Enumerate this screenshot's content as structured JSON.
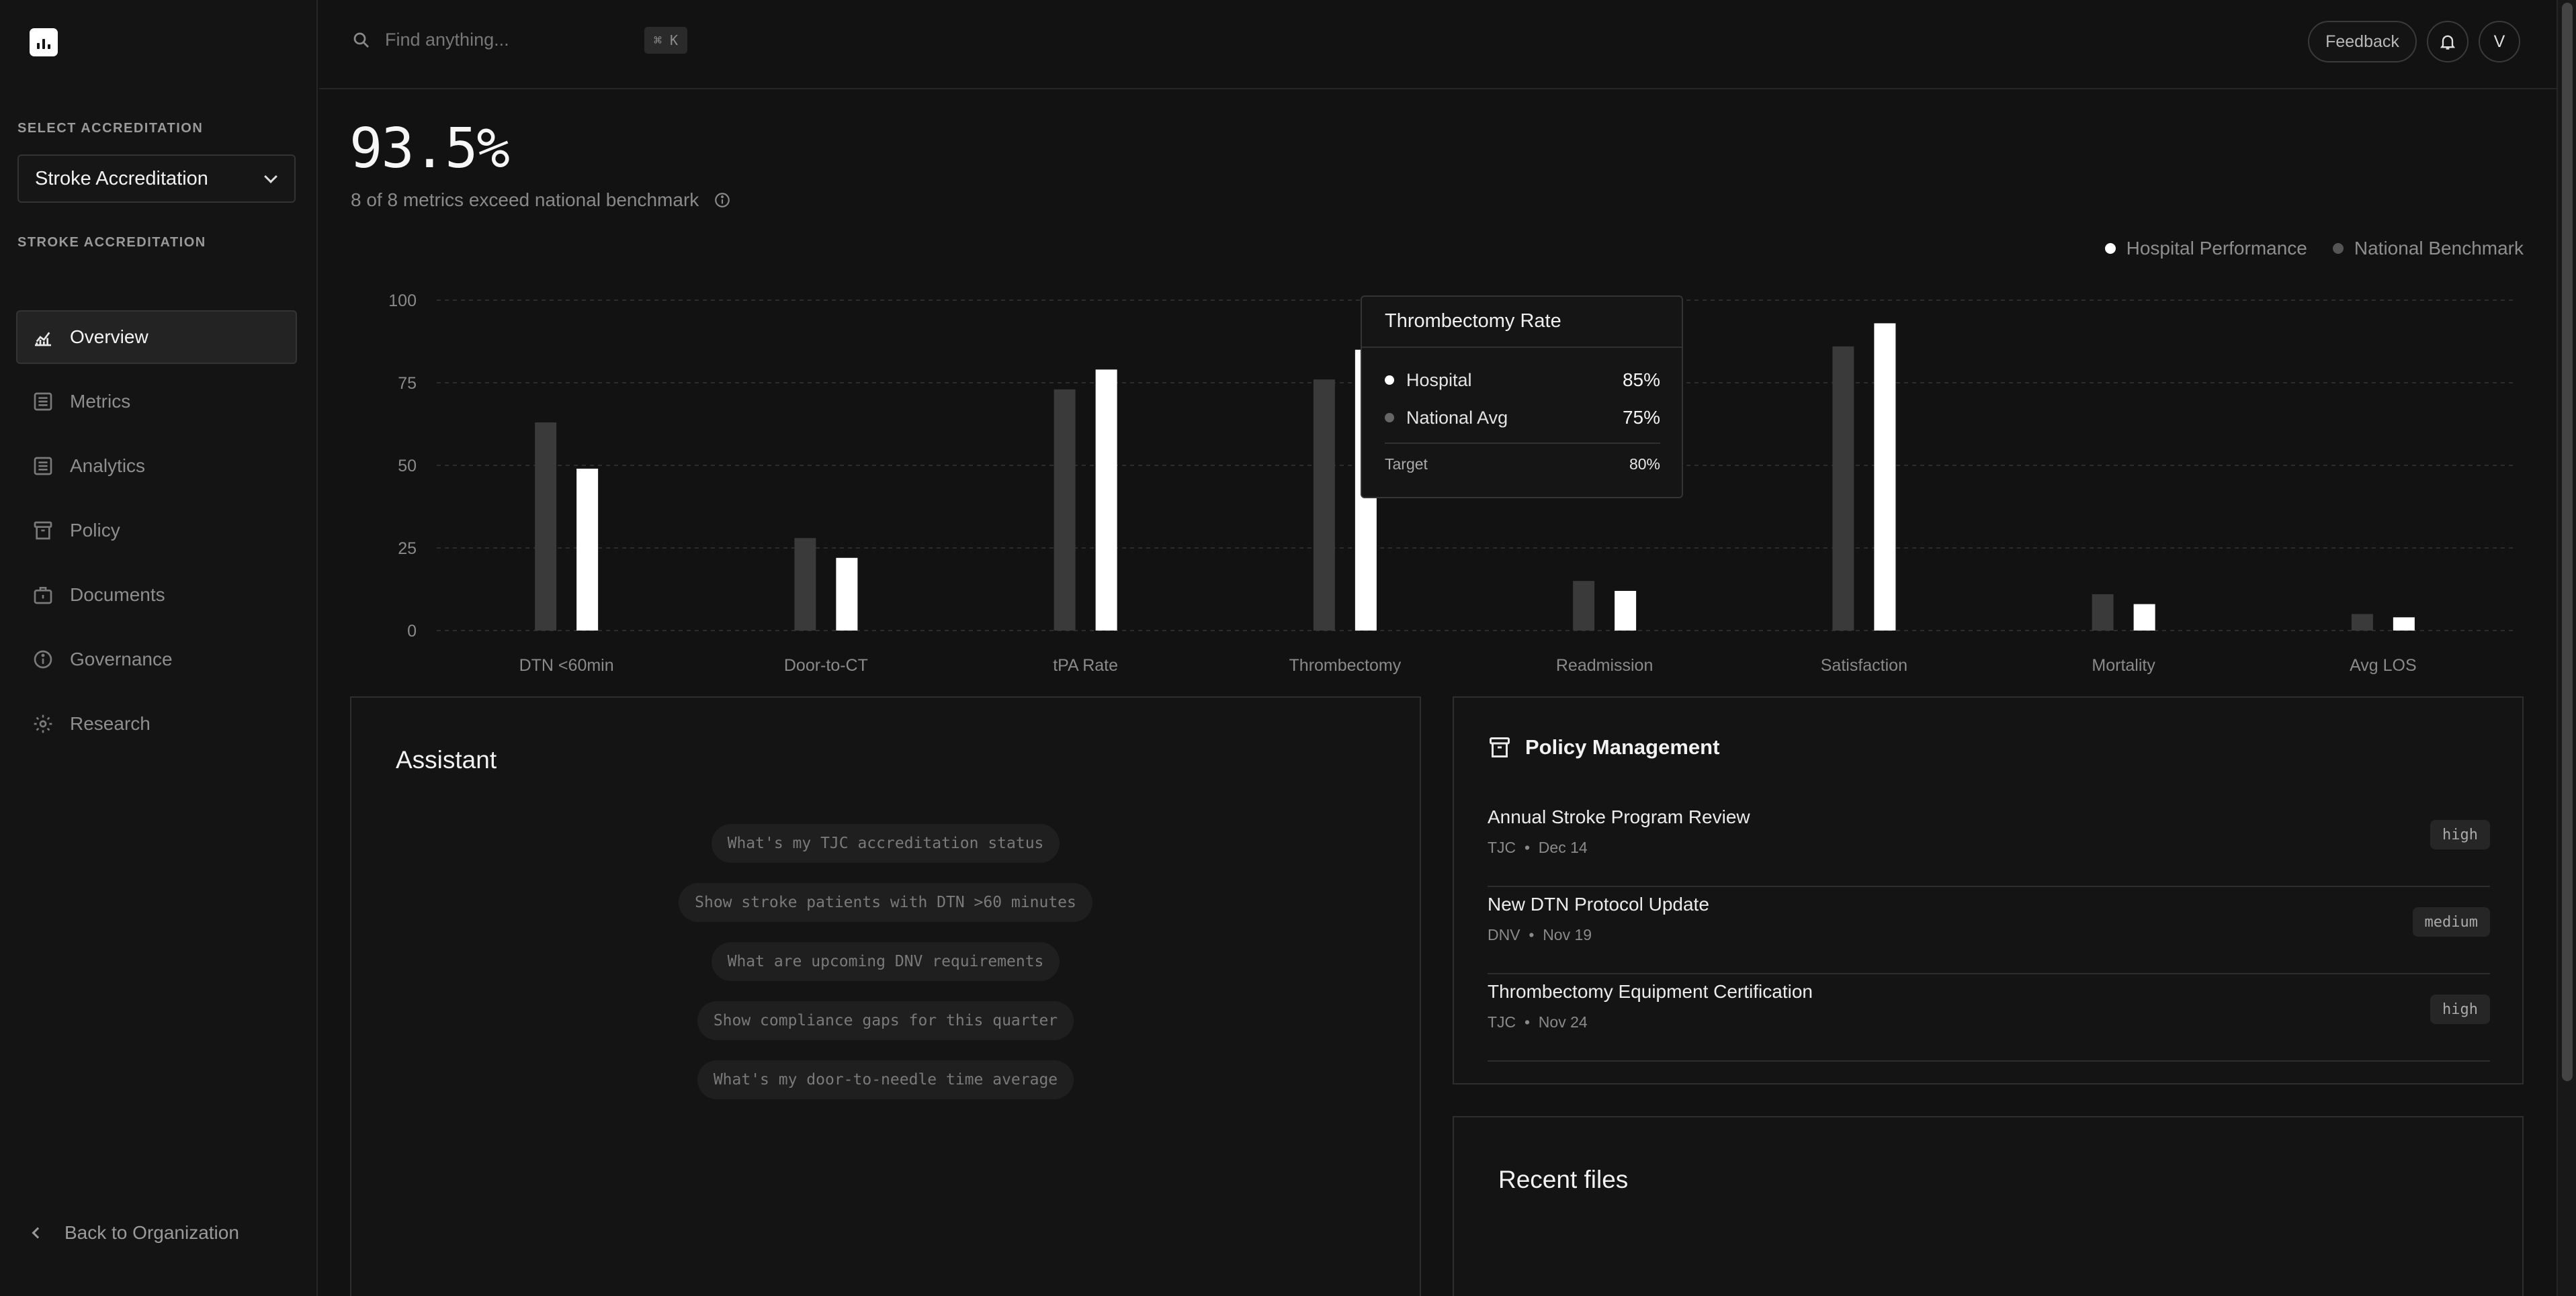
{
  "sidebar": {
    "select_label": "SELECT ACCREDITATION",
    "selected": "Stroke Accreditation",
    "section_label": "STROKE ACCREDITATION",
    "items": [
      {
        "label": "Overview",
        "icon": "chart-line-icon",
        "active": true
      },
      {
        "label": "Metrics",
        "icon": "list-icon"
      },
      {
        "label": "Analytics",
        "icon": "list-icon"
      },
      {
        "label": "Policy",
        "icon": "archive-icon"
      },
      {
        "label": "Documents",
        "icon": "briefcase-icon"
      },
      {
        "label": "Governance",
        "icon": "info-icon"
      },
      {
        "label": "Research",
        "icon": "gear-icon"
      }
    ],
    "back_label": "Back to Organization"
  },
  "topbar": {
    "search_placeholder": "Find anything...",
    "shortcut": "⌘ K",
    "feedback_label": "Feedback",
    "avatar_initial": "V"
  },
  "summary": {
    "value": "93.5%",
    "subtitle": "8 of 8 metrics exceed national benchmark"
  },
  "legend": {
    "hospital": "Hospital Performance",
    "national": "National Benchmark"
  },
  "colors": {
    "hospital": "#ffffff",
    "national": "#3a3a3a",
    "background": "#121212"
  },
  "chart_data": {
    "type": "bar",
    "categories": [
      "DTN <60min",
      "Door-to-CT",
      "tPA Rate",
      "Thrombectomy",
      "Readmission",
      "Satisfaction",
      "Mortality",
      "Avg LOS"
    ],
    "series": [
      {
        "name": "National Benchmark",
        "values": [
          63,
          28,
          73,
          76,
          15,
          86,
          11,
          5
        ]
      },
      {
        "name": "Hospital Performance",
        "values": [
          49,
          22,
          79,
          85,
          12,
          93,
          8,
          4
        ]
      }
    ],
    "ylim": [
      0,
      100
    ],
    "yticks": [
      "0",
      "25",
      "50",
      "75",
      "100"
    ],
    "grid": true,
    "legend_position": "top-right"
  },
  "tooltip": {
    "title": "Thrombectomy Rate",
    "hospital_label": "Hospital",
    "hospital_value": "85%",
    "national_label": "National Avg",
    "national_value": "75%",
    "target_label": "Target",
    "target_value": "80%"
  },
  "assistant": {
    "title": "Assistant",
    "suggestions": [
      "What's my TJC accreditation status",
      "Show stroke patients with DTN >60 minutes",
      "What are upcoming DNV requirements",
      "Show compliance gaps for this quarter",
      "What's my door-to-needle time average"
    ]
  },
  "policy": {
    "title": "Policy Management",
    "items": [
      {
        "title": "Annual Stroke Program Review",
        "org": "TJC",
        "date": "Dec 14",
        "priority": "high"
      },
      {
        "title": "New DTN Protocol Update",
        "org": "DNV",
        "date": "Nov 19",
        "priority": "medium"
      },
      {
        "title": "Thrombectomy Equipment Certification",
        "org": "TJC",
        "date": "Nov 24",
        "priority": "high"
      }
    ]
  },
  "files": {
    "title": "Recent files"
  }
}
